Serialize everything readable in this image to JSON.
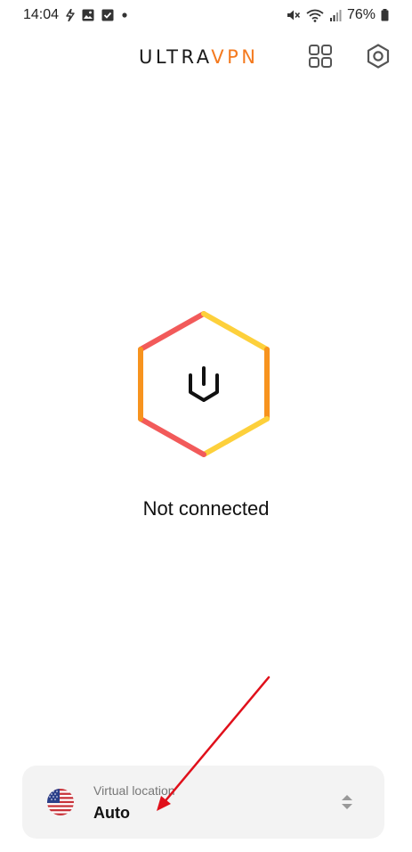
{
  "status_bar": {
    "time": "14:04",
    "battery": "76%",
    "left_icons": [
      "flash-icon",
      "image-icon",
      "checkbox-icon",
      "dot-icon"
    ],
    "right_icons": [
      "mute-icon",
      "wifi-icon",
      "signal-icon",
      "battery-icon"
    ]
  },
  "header": {
    "brand_prefix": "ULTRA",
    "brand_suffix": "VPN",
    "brand_accent_color": "#f47a1f",
    "icons": [
      "apps-grid-icon",
      "settings-hexagon-icon"
    ]
  },
  "main": {
    "status_text": "Not connected",
    "power_icon": "power-icon",
    "ring_colors": [
      "#f25a5a",
      "#fdd03b",
      "#f7931e"
    ]
  },
  "location": {
    "label": "Virtual location",
    "value": "Auto",
    "flag": "us-flag-icon",
    "selector_icon": "up-down-chevron-icon"
  },
  "annotation": {
    "color": "#e0101b",
    "type": "arrow"
  }
}
